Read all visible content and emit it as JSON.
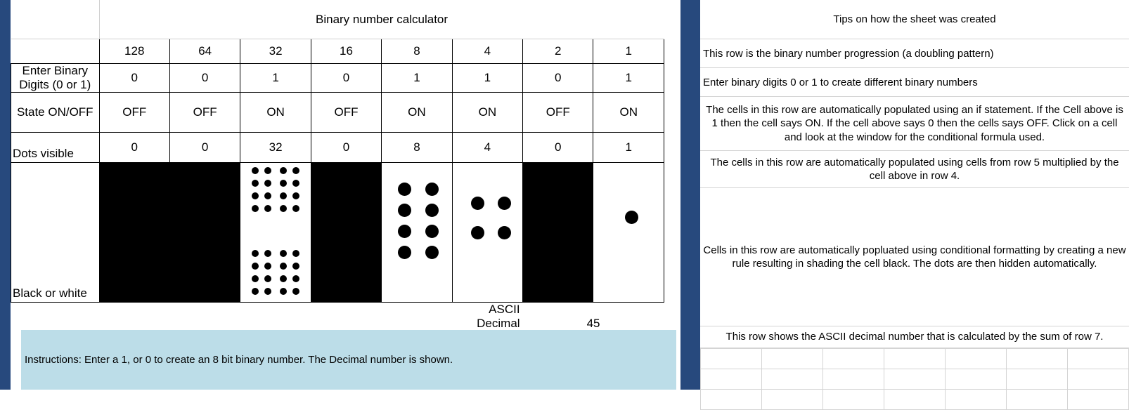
{
  "colors": {
    "accent_blue": "#27497d",
    "instructions_bg": "#bcdde8",
    "cell_black": "#000000",
    "grid_line": "#d4d4d4"
  },
  "left_panel": {
    "title": "Binary number calculator",
    "row_labels": {
      "place_values": "",
      "enter_digits": "Enter Binary Digits (0 or 1)",
      "state": "State ON/OFF",
      "dots_visible": "Dots visible",
      "black_or_white": "Black or white"
    },
    "place_values": [
      "128",
      "64",
      "32",
      "16",
      "8",
      "4",
      "2",
      "1"
    ],
    "binary_digits": [
      "0",
      "0",
      "1",
      "0",
      "1",
      "1",
      "0",
      "1"
    ],
    "states": [
      "OFF",
      "OFF",
      "ON",
      "OFF",
      "ON",
      "ON",
      "OFF",
      "ON"
    ],
    "dots_visible": [
      "0",
      "0",
      "32",
      "0",
      "8",
      "4",
      "0",
      "1"
    ],
    "black_or_white": [
      "black",
      "black",
      "white",
      "black",
      "white",
      "white",
      "black",
      "white"
    ],
    "ascii_label": "ASCII Decimal Number",
    "ascii_value": "45",
    "instructions": "Instructions: Enter a 1, or 0  to create an 8 bit binary number. The Decimal number is shown."
  },
  "right_panel": {
    "title": "Tips on how the sheet was created",
    "tips": [
      "This row is the binary number progression (a doubling pattern)",
      "Enter binary digits  0 or 1 to create different binary numbers",
      "The cells in this row are automatically populated using an if statement.  If the Cell above is 1 then the cell says ON. If the cell above says 0 then the cells says OFF. Click  on a cell and look at the window for the conditional formula used.",
      "The cells in this row are automatically populated using cells from row 5 multiplied by the cell above in row 4.",
      "Cells in this row are automatically popluated using conditional formatting by creating a new rule resulting in shading the cell black. The dots are then hidden automatically.",
      "This row shows the ASCII decimal number that is calculated by the sum of row 7."
    ]
  }
}
